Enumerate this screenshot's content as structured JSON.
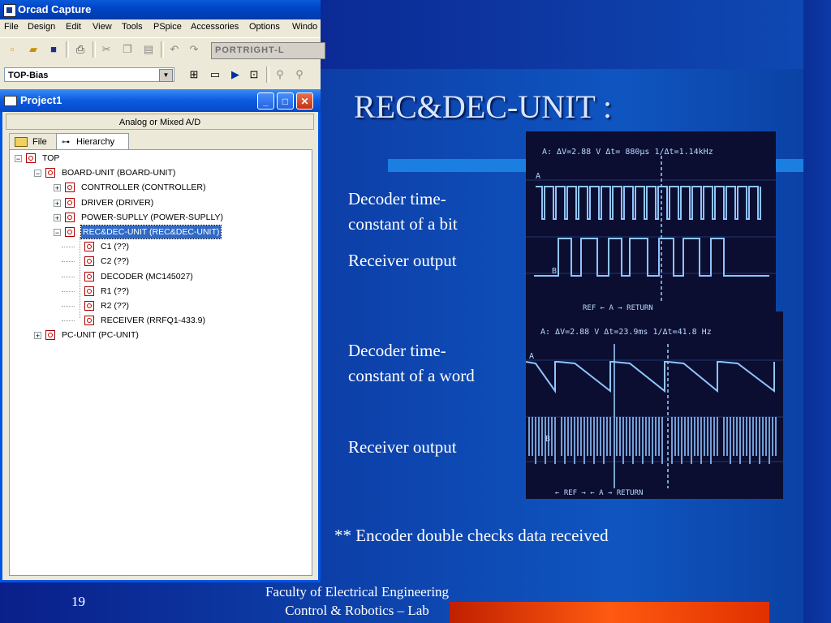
{
  "app": {
    "title": "Orcad Capture",
    "menu": [
      "File",
      "Design",
      "Edit",
      "View",
      "Tools",
      "PSpice",
      "Accessories",
      "Options",
      "Windo"
    ],
    "part_combo": "PORTRIGHT-L",
    "design_combo": "TOP-Bias",
    "project_window": {
      "title": "Project1",
      "mode_header": "Analog or Mixed A/D",
      "tabs": [
        "File",
        "Hierarchy"
      ],
      "tree": [
        {
          "label": "TOP",
          "level": 0,
          "expander": "−"
        },
        {
          "label": "BOARD-UNIT (BOARD-UNIT)",
          "level": 1,
          "expander": "−"
        },
        {
          "label": "CONTROLLER (CONTROLLER)",
          "level": 2,
          "expander": "+"
        },
        {
          "label": "DRIVER (DRIVER)",
          "level": 2,
          "expander": "+"
        },
        {
          "label": "POWER-SUPLLY (POWER-SUPLLY)",
          "level": 2,
          "expander": "+"
        },
        {
          "label": "REC&DEC-UNIT (REC&DEC-UNIT)",
          "level": 2,
          "expander": "−",
          "selected": true
        },
        {
          "label": "C1 (??)",
          "level": 3,
          "expander": ""
        },
        {
          "label": "C2 (??)",
          "level": 3,
          "expander": ""
        },
        {
          "label": "DECODER (MC145027)",
          "level": 3,
          "expander": ""
        },
        {
          "label": "R1 (??)",
          "level": 3,
          "expander": ""
        },
        {
          "label": "R2 (??)",
          "level": 3,
          "expander": ""
        },
        {
          "label": "RECEIVER (RRFQ1-433.9)",
          "level": 3,
          "expander": ""
        },
        {
          "label": "PC-UNIT (PC-UNIT)",
          "level": 1,
          "expander": "+"
        }
      ]
    }
  },
  "slide": {
    "title": "REC&DEC-UNIT :",
    "label_bit_decoder": "Decoder time-\nconstant of a bit",
    "label_bit_receiver": "Receiver output",
    "label_word_decoder": "Decoder time-\nconstant of a word",
    "label_word_receiver": "Receiver output",
    "note": "** Encoder double checks data received",
    "page_number": "19",
    "footer_line1": "Faculty of Electrical Engineering",
    "footer_line2": "Control & Robotics – Lab"
  },
  "scope_bit": {
    "header": "A: ΔV=2.88 V   Δt= 880μs 1/Δt=1.14kHz",
    "ch_a": "A",
    "ch_b": "B",
    "footer": "REF ←  A  →   RETURN"
  },
  "scope_word": {
    "header": "A: ΔV=2.88 V   Δt=23.9ms 1/Δt=41.8 Hz",
    "ch_a": "A",
    "ch_b": "B",
    "footer": "←  REF →   ←  A  →   RETURN"
  },
  "colors": {
    "slide_bg": "#0d3fa8",
    "accent_bar": "#1a7fe0",
    "footer_bar": "#ff5a10",
    "scope_trace": "#7fb8ff",
    "xp_title": "#0a5ae0",
    "selection": "#316ac5"
  }
}
